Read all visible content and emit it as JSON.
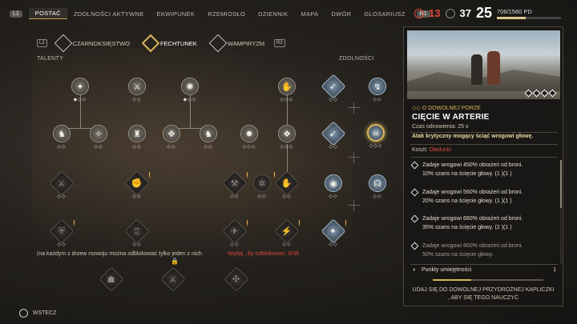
{
  "nav": {
    "left_key": "L1",
    "right_key": "R1",
    "tabs": [
      "POSTAĆ",
      "ZDOLNOŚCI AKTYWNE",
      "EKWIPUNEK",
      "RZEMIOSŁO",
      "DZIENNIK",
      "MAPA",
      "DWÓR",
      "GLOSARIUSZ"
    ],
    "active_tab": "POSTAĆ"
  },
  "stats": {
    "red_value": "13",
    "white_value": "37",
    "level": "25",
    "xp_text": "706/1560 PD",
    "xp_fraction": 0.45
  },
  "subtabs": {
    "left_key": "L2",
    "right_key": "R2",
    "items": [
      "CZARNOKSIĘSTWO",
      "FECHTUNEK",
      "WAMPIRYZM"
    ],
    "active": "FECHTUNEK"
  },
  "sections": {
    "talents": "TALENTY",
    "abilities": "ZDOLNOŚCI"
  },
  "notice": "(na każdym z drzew rozwoju można odblokować tylko jeden z nich",
  "notice_red": "Wydaj    , by odblokować: 8/35",
  "back_label": "WSTECZ",
  "detail": {
    "type": "O DOWOLNEJ PORZE",
    "title": "CIĘCIE W ARTERIE",
    "cooldown": "Czas odnowienia: 25 s",
    "description": "Atak krytyczny mogący ściąć wrogowi głowę.",
    "cost_label": "Koszt:",
    "cost_value": "Oładunki",
    "upgrades": [
      {
        "line1": "Zadaje wrogowi 450% obrażeń od broni.",
        "line2": "10% szans na ścięcie głowy.  (1  )(1  )"
      },
      {
        "line1": "Zadaje wrogowi 560% obrażeń od broni.",
        "line2": "20% szans na ścięcie głowy.  (1  )(1  )"
      },
      {
        "line1": "Zadaje wrogowi 680% obrażeń od broni.",
        "line2": "35% szans na ścięcie głowy.  (2  )(1  )"
      },
      {
        "line1": "Zadaje wrogowi 800% obrażeń od broni.",
        "line2": "50% szans na ścięcie głowy."
      }
    ],
    "points_label": "Punkty umiejętności",
    "points_value": "1",
    "points_fraction": 0.35,
    "hint_line1": "UDAJ SIĘ DO DOWOLNEJ PRZYDROŻNEJ KAPLICZKI",
    "hint_line2": ", ABY SIĘ TEGO NAUCZYĆ"
  },
  "icons": {
    "node_icon": "skill-icon",
    "lock_icon": "lock-icon",
    "back_icon": "circle-button-icon"
  }
}
